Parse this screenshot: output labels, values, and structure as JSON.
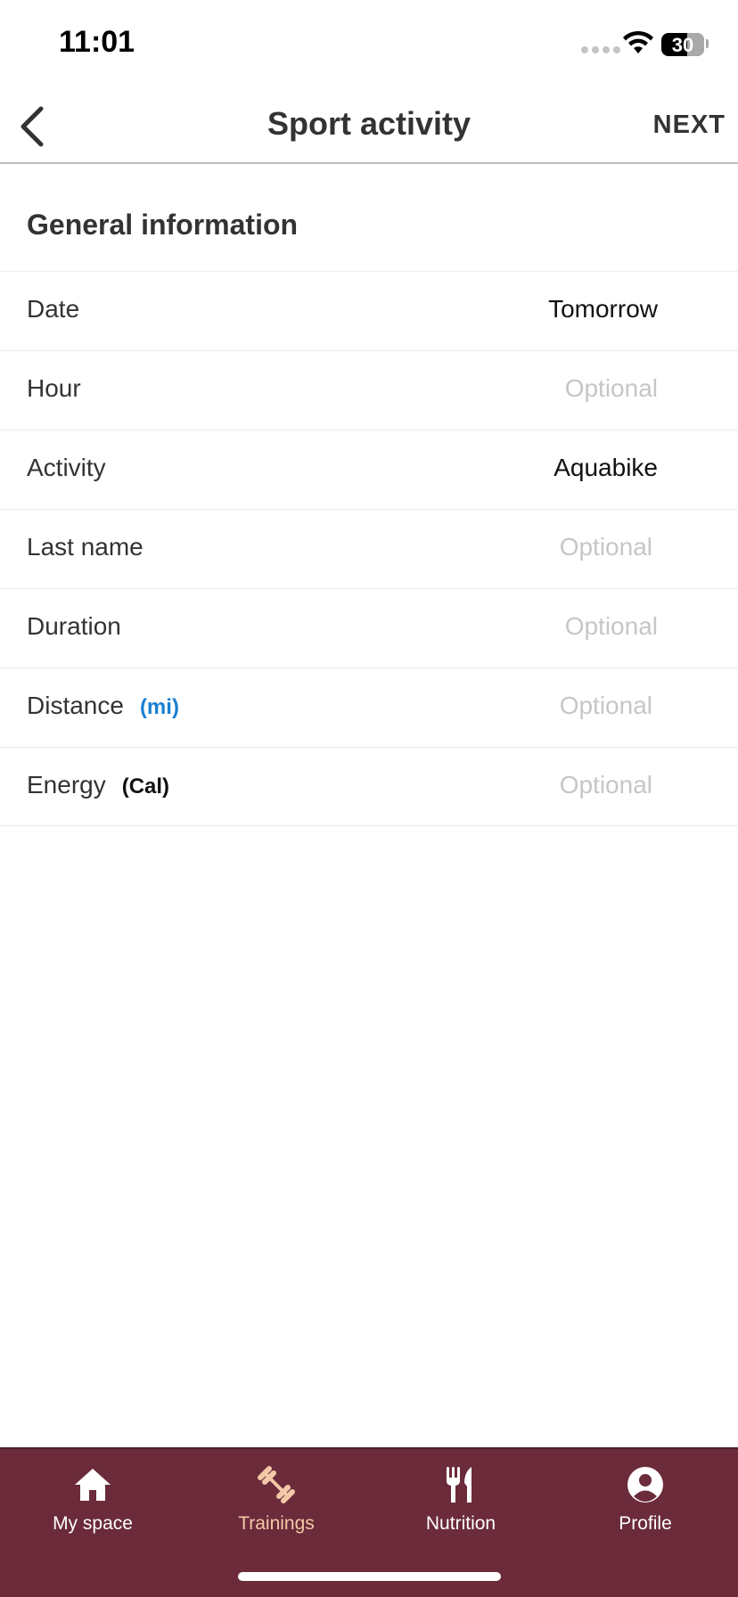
{
  "status_bar": {
    "time": "11:01",
    "battery": "30"
  },
  "header": {
    "title": "Sport activity",
    "next_label": "NEXT"
  },
  "section": {
    "title": "General information"
  },
  "form": {
    "rows": [
      {
        "label": "Date",
        "unit": "",
        "value": "Tomorrow",
        "placeholder": ""
      },
      {
        "label": "Hour",
        "unit": "",
        "value": "",
        "placeholder": "Optional"
      },
      {
        "label": "Activity",
        "unit": "",
        "value": "Aquabike",
        "placeholder": ""
      },
      {
        "label": "Last name",
        "unit": "",
        "value": "",
        "placeholder": "Optional"
      },
      {
        "label": "Duration",
        "unit": "",
        "value": "",
        "placeholder": "Optional"
      },
      {
        "label": "Distance",
        "unit": "(mi)",
        "value": "",
        "placeholder": "Optional"
      },
      {
        "label": "Energy",
        "unit": "(Cal)",
        "value": "",
        "placeholder": "Optional"
      }
    ]
  },
  "tab_bar": {
    "tabs": [
      {
        "label": "My space",
        "icon": "home-icon"
      },
      {
        "label": "Trainings",
        "icon": "dumbbell-icon"
      },
      {
        "label": "Nutrition",
        "icon": "fork-knife-icon"
      },
      {
        "label": "Profile",
        "icon": "profile-icon"
      }
    ],
    "active_index": 1
  },
  "colors": {
    "tab_bar_background": "#6b2b3a",
    "tab_active": "#f3c9a8",
    "unit_link": "#1a7fd1",
    "placeholder": "#c6c6c6"
  }
}
